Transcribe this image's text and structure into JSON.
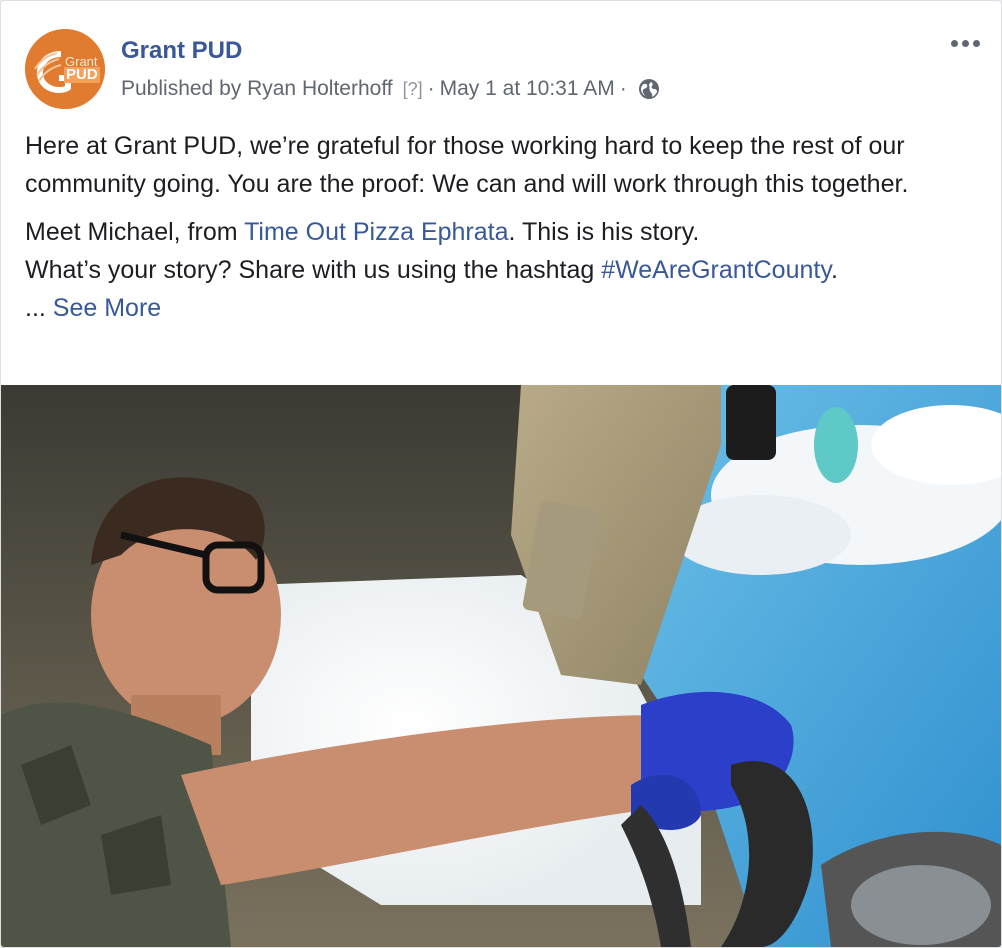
{
  "post": {
    "page_name": "Grant PUD",
    "avatar": {
      "line1": "Grant",
      "line2": "PUD",
      "icon": "grant-pud-logo",
      "bg_color": "#e07b30"
    },
    "published_by": "Published by Ryan Holterhoff",
    "help_mark": "[?]",
    "separator": "·",
    "timestamp": "May 1 at 10:31 AM",
    "audience_icon": "globe-icon",
    "more_icon": "more-options-icon",
    "text": {
      "para1": "Here at Grant PUD, we’re grateful for those working hard to keep the rest of our community going. You are the proof: We can and will work through this together.",
      "para2_prefix": "Meet Michael, from ",
      "para2_link": "Time Out Pizza Ephrata",
      "para2_suffix": ". This is his story.",
      "para3_prefix": "What’s your story? Share with us using the hashtag ",
      "para3_hashtag": "#WeAreGrantCounty",
      "para3_suffix": ".",
      "ellipsis": "... ",
      "see_more": "See More"
    },
    "photo": {
      "subject": "man-driving-car-photo"
    }
  },
  "colors": {
    "link": "#385898",
    "text": "#1c1e21",
    "meta": "#606770",
    "brand_orange": "#e07b30"
  }
}
